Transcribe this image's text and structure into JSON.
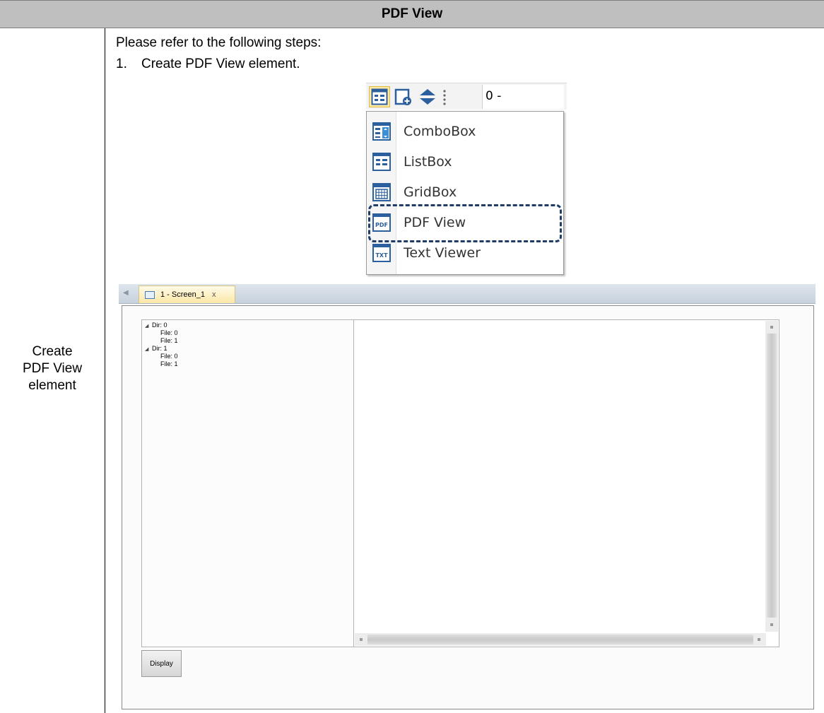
{
  "header": {
    "title": "PDF View"
  },
  "row_label": [
    "Create",
    "PDF View",
    "element"
  ],
  "intro": "Please refer to the following steps:",
  "steps": [
    {
      "number": "1.",
      "text": "Create PDF View element."
    }
  ],
  "toolbar": {
    "buttons": [
      "list-element-icon",
      "new-screen-icon",
      "layer-icon"
    ],
    "field_value": "0 -"
  },
  "menu": {
    "items": [
      {
        "label": "ComboBox",
        "icon": "combobox-icon"
      },
      {
        "label": "ListBox",
        "icon": "listbox-icon"
      },
      {
        "label": "GridBox",
        "icon": "gridbox-icon"
      },
      {
        "label": "PDF View",
        "icon": "pdf-view-icon",
        "highlighted": true
      },
      {
        "label": "Text Viewer",
        "icon": "text-viewer-icon"
      }
    ]
  },
  "editor": {
    "tab_label": "1 - Screen_1",
    "tab_close": "x",
    "tree": [
      {
        "label": "Dir: 0",
        "level": 0
      },
      {
        "label": "File: 0",
        "level": 1
      },
      {
        "label": "File: 1",
        "level": 1
      },
      {
        "label": "Dir: 1",
        "level": 0
      },
      {
        "label": "File: 0",
        "level": 1
      },
      {
        "label": "File: 1",
        "level": 1
      }
    ],
    "display_button": "Display"
  },
  "colors": {
    "header_bg": "#bfbfbf",
    "highlight_border": "#1f3d66",
    "tab_bg": "#fbe7a6"
  }
}
